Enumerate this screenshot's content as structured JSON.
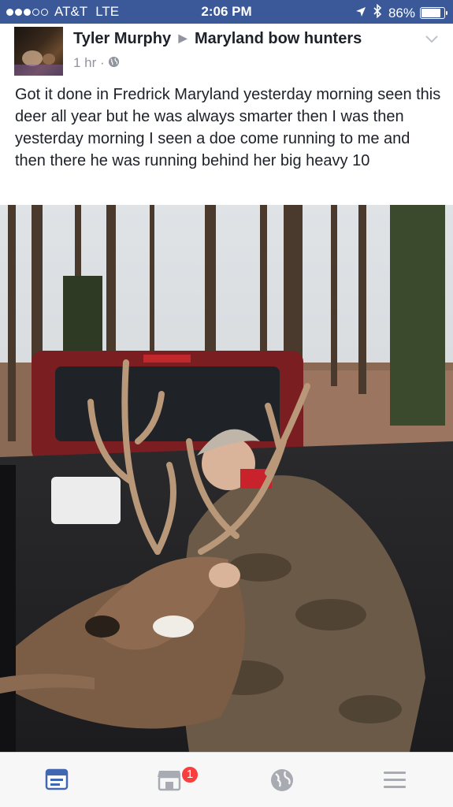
{
  "status_bar": {
    "carrier": "AT&T",
    "network": "LTE",
    "time": "2:06 PM",
    "battery_percent": "86%",
    "battery_level": 0.86,
    "signal_bars_filled": 3,
    "signal_bars_total": 5,
    "icons": [
      "location-arrow-icon",
      "bluetooth-icon",
      "battery-icon"
    ]
  },
  "post": {
    "author": "Tyler Murphy",
    "group": "Maryland bow hunters",
    "time_ago": "1 hr",
    "separator": "·",
    "privacy_icon": "globe-icon",
    "text": "Got it done in Fredrick Maryland yesterday morning seen this deer all year but he was always smarter then I was then yesterday morning I seen a doe come running to me and then there he was running behind her big heavy 10",
    "menu_icon": "chevron-down-icon"
  },
  "tab_bar": {
    "tabs": [
      {
        "name": "news-feed",
        "icon": "news-feed-icon",
        "active": true
      },
      {
        "name": "marketplace",
        "icon": "marketplace-icon",
        "badge": "1"
      },
      {
        "name": "notifications",
        "icon": "globe-icon"
      },
      {
        "name": "menu",
        "icon": "hamburger-menu-icon"
      }
    ]
  },
  "colors": {
    "brand_blue": "#3b5998",
    "active_tab": "#4267b2",
    "inactive_tab": "#a8abb1",
    "badge_red": "#fa3e3e",
    "text_primary": "#1d2129",
    "text_secondary": "#90949c"
  }
}
